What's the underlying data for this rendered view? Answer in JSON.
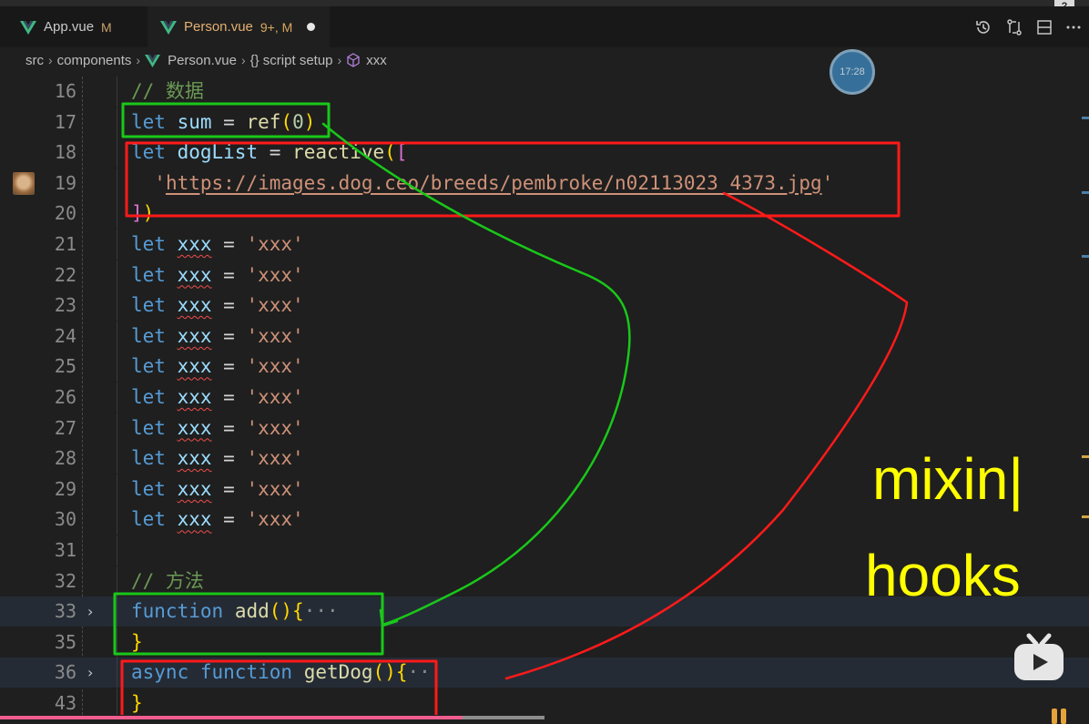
{
  "tabs": [
    {
      "label": "App.vue",
      "status": "M",
      "active": false
    },
    {
      "label": "Person.vue",
      "status": "9+, M",
      "active": true
    }
  ],
  "help_badge": "?",
  "breadcrumb": [
    "src",
    "components",
    "Person.vue",
    "{} script setup",
    "xxx"
  ],
  "timer": "17:28",
  "editor": {
    "lines": [
      {
        "number": "16",
        "tokens": [
          {
            "t": "// 数据",
            "c": "cm"
          }
        ]
      },
      {
        "number": "17",
        "tokens": [
          {
            "t": "let",
            "c": "kw"
          },
          {
            "t": " "
          },
          {
            "t": "sum",
            "c": "var"
          },
          {
            "t": " = "
          },
          {
            "t": "ref",
            "c": "fn"
          },
          {
            "t": "(",
            "c": "br1"
          },
          {
            "t": "0",
            "c": "num"
          },
          {
            "t": ")",
            "c": "br1"
          }
        ]
      },
      {
        "number": "18",
        "tokens": [
          {
            "t": "let",
            "c": "kw"
          },
          {
            "t": " "
          },
          {
            "t": "dogList",
            "c": "var"
          },
          {
            "t": " = "
          },
          {
            "t": "reactive",
            "c": "fn"
          },
          {
            "t": "(",
            "c": "br1"
          },
          {
            "t": "[",
            "c": "br2"
          }
        ]
      },
      {
        "number": "19",
        "thumb": true,
        "tokens": [
          {
            "t": "  "
          },
          {
            "t": "'",
            "c": "str"
          },
          {
            "t": "https://images.dog.ceo/breeds/pembroke/n02113023_4373.jpg",
            "c": "str url"
          },
          {
            "t": "'",
            "c": "str"
          }
        ]
      },
      {
        "number": "20",
        "tokens": [
          {
            "t": "]",
            "c": "br2"
          },
          {
            "t": ")",
            "c": "br1"
          }
        ]
      },
      {
        "number": "21",
        "tokens": [
          {
            "t": "let",
            "c": "kw"
          },
          {
            "t": " "
          },
          {
            "t": "xxx",
            "c": "var squig"
          },
          {
            "t": " = "
          },
          {
            "t": "'xxx'",
            "c": "str"
          }
        ]
      },
      {
        "number": "22",
        "tokens": [
          {
            "t": "let",
            "c": "kw"
          },
          {
            "t": " "
          },
          {
            "t": "xxx",
            "c": "var squig"
          },
          {
            "t": " = "
          },
          {
            "t": "'xxx'",
            "c": "str"
          }
        ]
      },
      {
        "number": "23",
        "tokens": [
          {
            "t": "let",
            "c": "kw"
          },
          {
            "t": " "
          },
          {
            "t": "xxx",
            "c": "var squig"
          },
          {
            "t": " = "
          },
          {
            "t": "'xxx'",
            "c": "str"
          }
        ]
      },
      {
        "number": "24",
        "tokens": [
          {
            "t": "let",
            "c": "kw"
          },
          {
            "t": " "
          },
          {
            "t": "xxx",
            "c": "var squig"
          },
          {
            "t": " = "
          },
          {
            "t": "'xxx'",
            "c": "str"
          }
        ]
      },
      {
        "number": "25",
        "tokens": [
          {
            "t": "let",
            "c": "kw"
          },
          {
            "t": " "
          },
          {
            "t": "xxx",
            "c": "var squig"
          },
          {
            "t": " = "
          },
          {
            "t": "'xxx'",
            "c": "str"
          }
        ]
      },
      {
        "number": "26",
        "tokens": [
          {
            "t": "let",
            "c": "kw"
          },
          {
            "t": " "
          },
          {
            "t": "xxx",
            "c": "var squig"
          },
          {
            "t": " = "
          },
          {
            "t": "'xxx'",
            "c": "str"
          }
        ]
      },
      {
        "number": "27",
        "tokens": [
          {
            "t": "let",
            "c": "kw"
          },
          {
            "t": " "
          },
          {
            "t": "xxx",
            "c": "var squig"
          },
          {
            "t": " = "
          },
          {
            "t": "'xxx'",
            "c": "str"
          }
        ]
      },
      {
        "number": "28",
        "tokens": [
          {
            "t": "let",
            "c": "kw"
          },
          {
            "t": " "
          },
          {
            "t": "xxx",
            "c": "var squig"
          },
          {
            "t": " = "
          },
          {
            "t": "'xxx'",
            "c": "str"
          }
        ]
      },
      {
        "number": "29",
        "tokens": [
          {
            "t": "let",
            "c": "kw"
          },
          {
            "t": " "
          },
          {
            "t": "xxx",
            "c": "var squig"
          },
          {
            "t": " = "
          },
          {
            "t": "'xxx'",
            "c": "str"
          }
        ]
      },
      {
        "number": "30",
        "tokens": [
          {
            "t": "let",
            "c": "kw"
          },
          {
            "t": " "
          },
          {
            "t": "xxx",
            "c": "var squig"
          },
          {
            "t": " = "
          },
          {
            "t": "'xxx'",
            "c": "str"
          }
        ]
      },
      {
        "number": "31",
        "tokens": []
      },
      {
        "number": "32",
        "tokens": [
          {
            "t": "// 方法",
            "c": "cm"
          }
        ]
      },
      {
        "number": "33",
        "folded": true,
        "highlight": true,
        "tokens": [
          {
            "t": "function",
            "c": "kw"
          },
          {
            "t": " "
          },
          {
            "t": "add",
            "c": "fn"
          },
          {
            "t": "()",
            "c": "br1"
          },
          {
            "t": "{",
            "c": "br1"
          },
          {
            "t": "···",
            "c": "ellip"
          }
        ]
      },
      {
        "number": "35",
        "tokens": [
          {
            "t": "}",
            "c": "br1"
          }
        ]
      },
      {
        "number": "36",
        "folded": true,
        "highlight": true,
        "tokens": [
          {
            "t": "async",
            "c": "kw"
          },
          {
            "t": " "
          },
          {
            "t": "function",
            "c": "kw"
          },
          {
            "t": " "
          },
          {
            "t": "getDog",
            "c": "fn"
          },
          {
            "t": "()",
            "c": "br1"
          },
          {
            "t": "{",
            "c": "br1"
          },
          {
            "t": "···",
            "c": "ellip"
          }
        ]
      },
      {
        "number": "43",
        "tokens": [
          {
            "t": "}",
            "c": "br1"
          }
        ]
      }
    ]
  },
  "annotations": {
    "mixin_text": "mixin|",
    "hooks_text": "hooks",
    "green_color": "#19c819",
    "red_color": "#ff1a1a",
    "text_color": "#ffff00"
  },
  "player": {
    "progress_played_fraction": 0.425,
    "progress_buffered_fraction": 0.5
  },
  "colors": {
    "editor_bg": "#1f1f1f",
    "tab_active_label": "#e3b071",
    "keyword": "#569cd6",
    "function": "#dcdcaa",
    "variable": "#9cdcfe",
    "string": "#ce9178",
    "comment": "#6a9955",
    "progress": "#f25d8e"
  },
  "icons": [
    "vue-icon",
    "history-icon",
    "compare-changes-icon",
    "split-editor-icon",
    "more-icon",
    "symbol-variable-icon",
    "bilibili-tv-icon",
    "fold-chevron-icon"
  ]
}
